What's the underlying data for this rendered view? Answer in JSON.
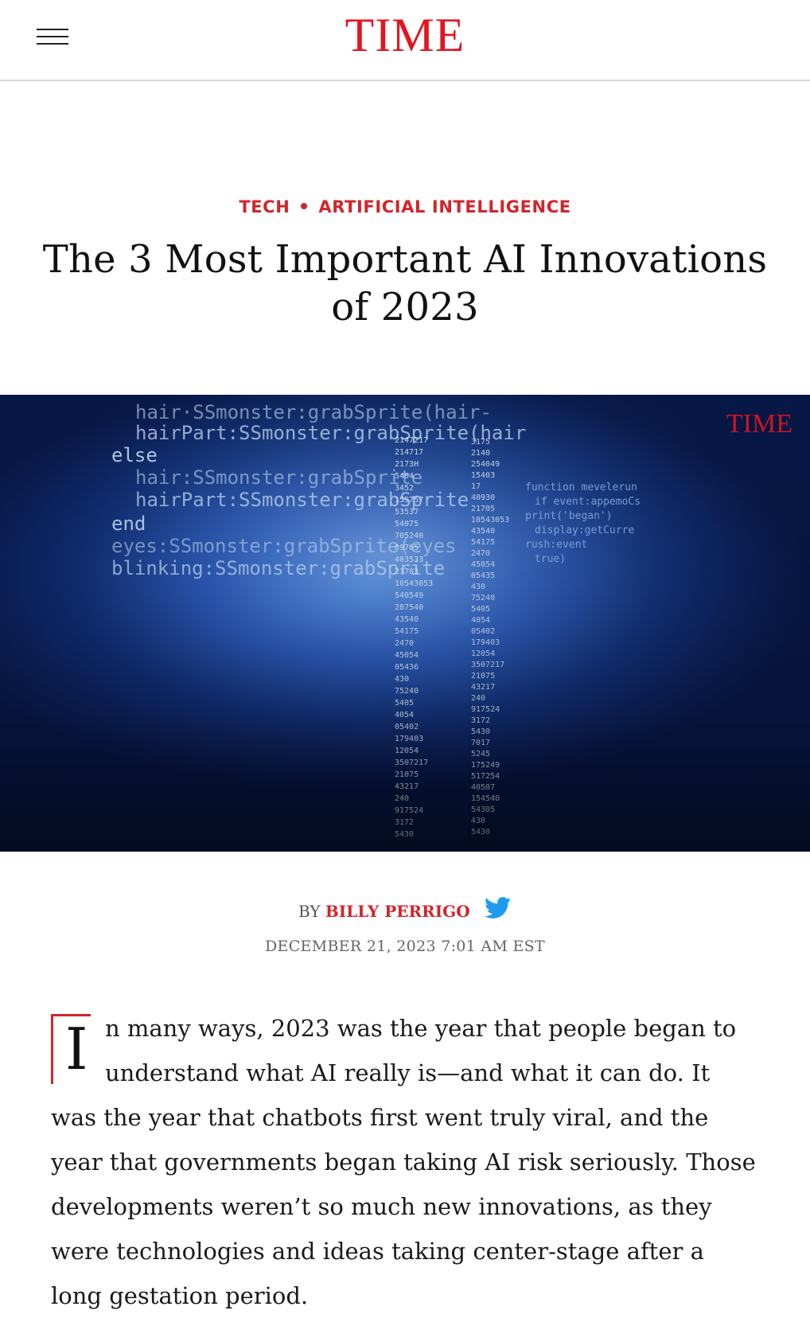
{
  "header": {
    "menu_icon": "hamburger-menu-icon",
    "logo": "TIME"
  },
  "article": {
    "categories": [
      "TECH",
      "ARTIFICIAL INTELLIGENCE"
    ],
    "headline": "The 3 Most Important AI Innovations of 2023",
    "hero": {
      "watermark": "TIME",
      "code_lines": [
        "hair·SSmonster:grabSprite(hair-",
        "hairPart:SSmonster:grabSprite(hair",
        "else",
        "hair:SSmonster:grabSprite",
        "hairPart:SSmonster:grabSprite",
        "end",
        "eyes:SSmonster:grabSprite(eyes",
        "blinking:SSmonster:grabSprite"
      ],
      "numbers_left": [
        "2147217",
        "214717",
        "2173H",
        "5404",
        "3452",
        "155757",
        "53537",
        "54075",
        "705240",
        "89765",
        "403533",
        "21703",
        "10543053",
        "540549",
        "287540",
        "43540",
        "54175",
        "2470",
        "45054",
        "05436",
        "430",
        "75240",
        "5405",
        "4054",
        "05402",
        "179403",
        "12054",
        "3507217",
        "21075",
        "43217",
        "240",
        "917524",
        "3172",
        "5430"
      ],
      "numbers_right": [
        "3175",
        "2140",
        "254049",
        "15403",
        "17",
        "40930",
        "21705",
        "10543053",
        "43540",
        "54175",
        "2470",
        "45054",
        "05435",
        "430",
        "75240",
        "5405",
        "4054",
        "05402",
        "179403",
        "12054",
        "3507217",
        "21075",
        "43217",
        "240",
        "917524",
        "3172",
        "5430",
        "7017",
        "5245",
        "175249",
        "517254",
        "40507",
        "154540",
        "54305",
        "430",
        "5430"
      ],
      "code_right": [
        "function mevelerun",
        "if event:appemoCs",
        "print('began')",
        "display:getCurre",
        "rush:event",
        "true)"
      ]
    },
    "byline": {
      "by_label": "BY",
      "author": "BILLY PERRIGO",
      "twitter_icon": "twitter-bird-icon"
    },
    "date": "DECEMBER 21, 2023 7:01 AM EST",
    "body": {
      "drop_cap": "I",
      "first_paragraph": "n many ways, 2023 was the year that people began to understand what AI really is—and what it can do. It was the year that chatbots first went truly viral, and the year that governments began taking AI risk seriously. Those developments weren’t so much new innovations, as they were technologies and ideas taking center-stage after a long gestation period."
    }
  },
  "colors": {
    "brand_red": "#e4141e",
    "category_red": "#d3242b",
    "twitter_blue": "#1d9bf0"
  }
}
